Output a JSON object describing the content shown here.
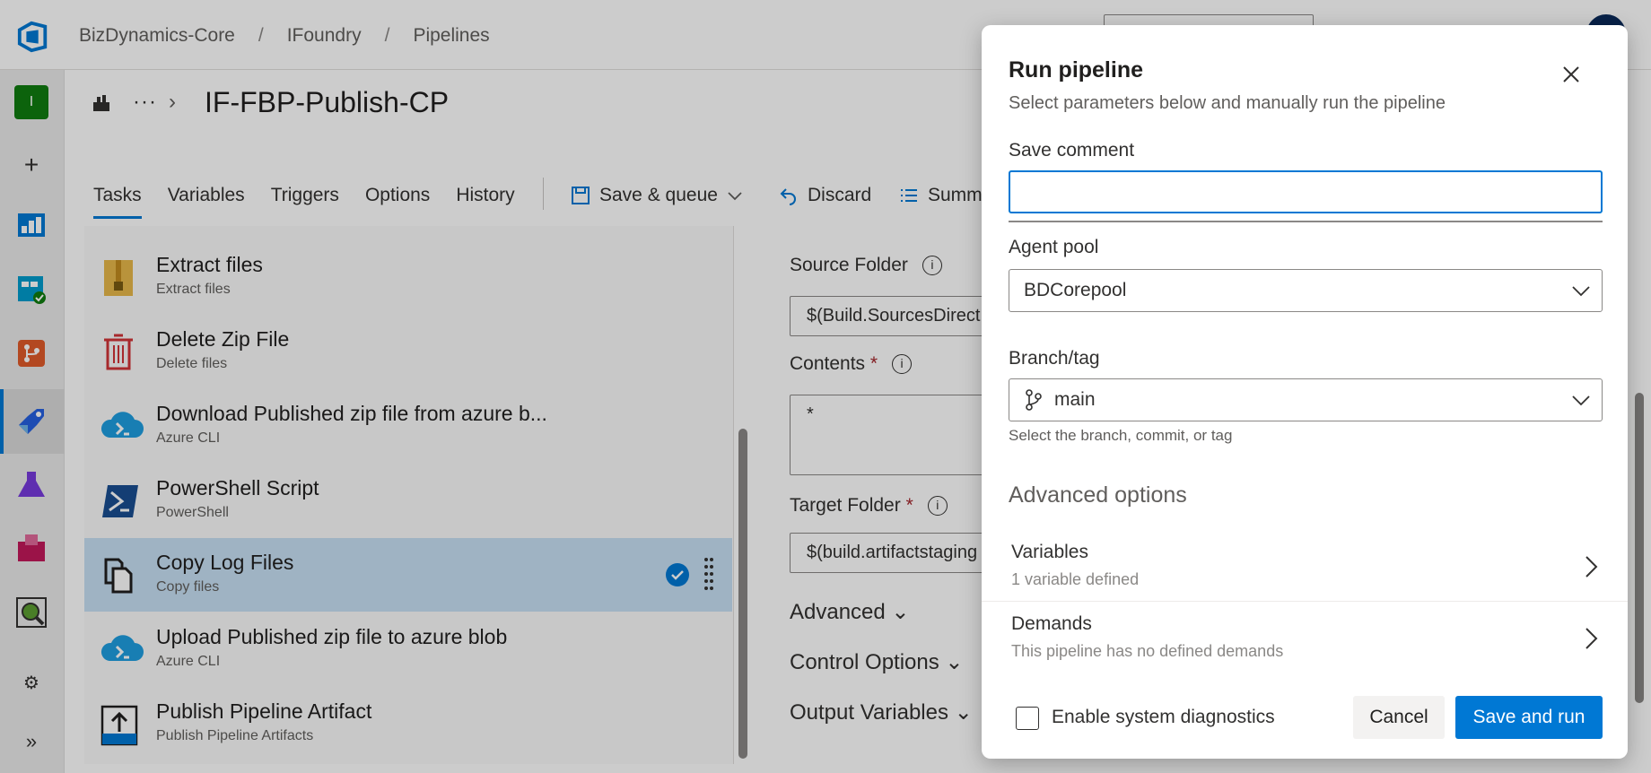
{
  "breadcrumb": {
    "org": "BizDynamics-Core",
    "project": "IFoundry",
    "section": "Pipelines",
    "separator": "/"
  },
  "pipeline": {
    "ellipsis": "···",
    "name": "IF-FBP-Publish-CP"
  },
  "tabs": [
    {
      "label": "Tasks",
      "active": true
    },
    {
      "label": "Variables"
    },
    {
      "label": "Triggers"
    },
    {
      "label": "Options"
    },
    {
      "label": "History"
    }
  ],
  "toolbar": {
    "save_queue": "Save & queue",
    "discard": "Discard",
    "summary": "Summ"
  },
  "tasks": [
    {
      "name": "Extract files",
      "sub": "Extract files",
      "icon": "zip-icon"
    },
    {
      "name": "Delete Zip File",
      "sub": "Delete files",
      "icon": "trash-icon"
    },
    {
      "name": "Download Published zip file from azure b...",
      "sub": "Azure CLI",
      "icon": "azure-cli-icon"
    },
    {
      "name": "PowerShell Script",
      "sub": "PowerShell",
      "icon": "powershell-icon"
    },
    {
      "name": "Copy Log Files",
      "sub": "Copy files",
      "icon": "copy-files-icon",
      "selected": true
    },
    {
      "name": "Upload Published zip file to azure blob",
      "sub": "Azure CLI",
      "icon": "azure-cli-icon"
    },
    {
      "name": "Publish Pipeline Artifact",
      "sub": "Publish Pipeline Artifacts",
      "icon": "publish-artifact-icon"
    }
  ],
  "detail": {
    "source_folder_label": "Source Folder",
    "source_folder_value": "$(Build.SourcesDirect",
    "contents_label": "Contents",
    "contents_value": "*",
    "target_folder_label": "Target Folder",
    "target_folder_value": "$(build.artifactstaging",
    "required_mark": "*",
    "info_glyph": "i",
    "advanced": "Advanced",
    "control_options": "Control Options",
    "output_variables": "Output Variables"
  },
  "dialog": {
    "title": "Run pipeline",
    "subtitle": "Select parameters below and manually run the pipeline",
    "save_comment_label": "Save comment",
    "save_comment_value": "",
    "agent_pool_label": "Agent pool",
    "agent_pool_value": "BDCorepool",
    "branch_label": "Branch/tag",
    "branch_value": "main",
    "branch_helper": "Select the branch, commit, or tag",
    "advanced_options": "Advanced options",
    "variables_title": "Variables",
    "variables_sub": "1 variable defined",
    "demands_title": "Demands",
    "demands_sub": "This pipeline has no defined demands",
    "diagnostics_label": "Enable system diagnostics",
    "diagnostics_checked": false,
    "cancel": "Cancel",
    "save_and_run": "Save and run"
  },
  "colors": {
    "accent": "#0078d4",
    "selected_row": "#c7e0f4",
    "required": "#a4262c"
  }
}
